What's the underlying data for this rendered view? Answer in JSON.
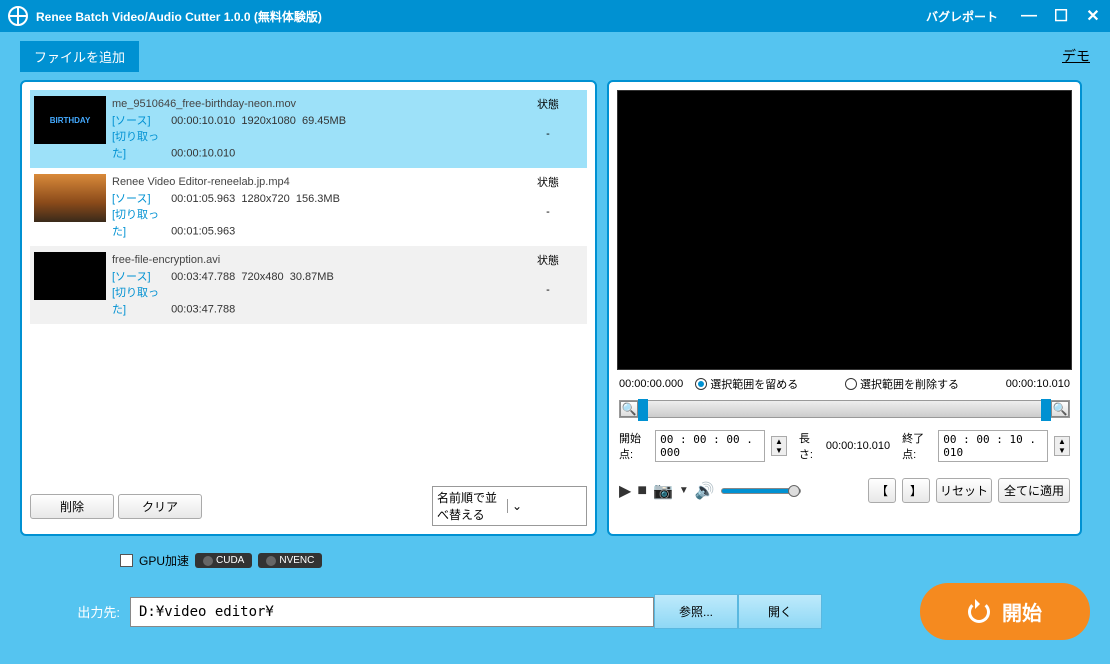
{
  "titlebar": {
    "title": "Renee Batch Video/Audio Cutter 1.0.0 (無料体験版)",
    "bug_report": "バグレポート"
  },
  "toolbar": {
    "add_file": "ファイルを追加",
    "demo": "デモ"
  },
  "file_list": {
    "status_header": "状態",
    "source_label": "[ソース]",
    "cut_label": "[切り取った]",
    "items": [
      {
        "name": "me_9510646_free-birthday-neon.mov",
        "source_time": "00:00:10.010",
        "resolution": "1920x1080",
        "size": "69.45MB",
        "cut_time": "00:00:10.010",
        "status": "-",
        "selected": true
      },
      {
        "name": "Renee Video Editor-reneelab.jp.mp4",
        "source_time": "00:01:05.963",
        "resolution": "1280x720",
        "size": "156.3MB",
        "cut_time": "00:01:05.963",
        "status": "-",
        "selected": false
      },
      {
        "name": "free-file-encryption.avi",
        "source_time": "00:03:47.788",
        "resolution": "720x480",
        "size": "30.87MB",
        "cut_time": "00:03:47.788",
        "status": "-",
        "selected": false
      }
    ]
  },
  "left_buttons": {
    "delete": "削除",
    "clear": "クリア",
    "sort": "名前順で並べ替える"
  },
  "preview": {
    "time_start": "00:00:00.000",
    "keep_range": "選択範囲を留める",
    "delete_range": "選択範囲を削除する",
    "time_end": "00:00:10.010",
    "start_label": "開始点:",
    "start_value": "00 : 00 : 00 . 000",
    "length_label": "長さ:",
    "length_value": "00:00:10.010",
    "end_label": "終了点:",
    "end_value": "00 : 00 : 10 . 010",
    "reset": "リセット",
    "apply_all": "全てに適用"
  },
  "footer": {
    "gpu_label": "GPU加速",
    "cuda": "CUDA",
    "nvenc": "NVENC",
    "output_label": "出力先:",
    "output_path": "D:¥video editor¥",
    "browse": "参照...",
    "open": "開く",
    "start": "開始"
  }
}
